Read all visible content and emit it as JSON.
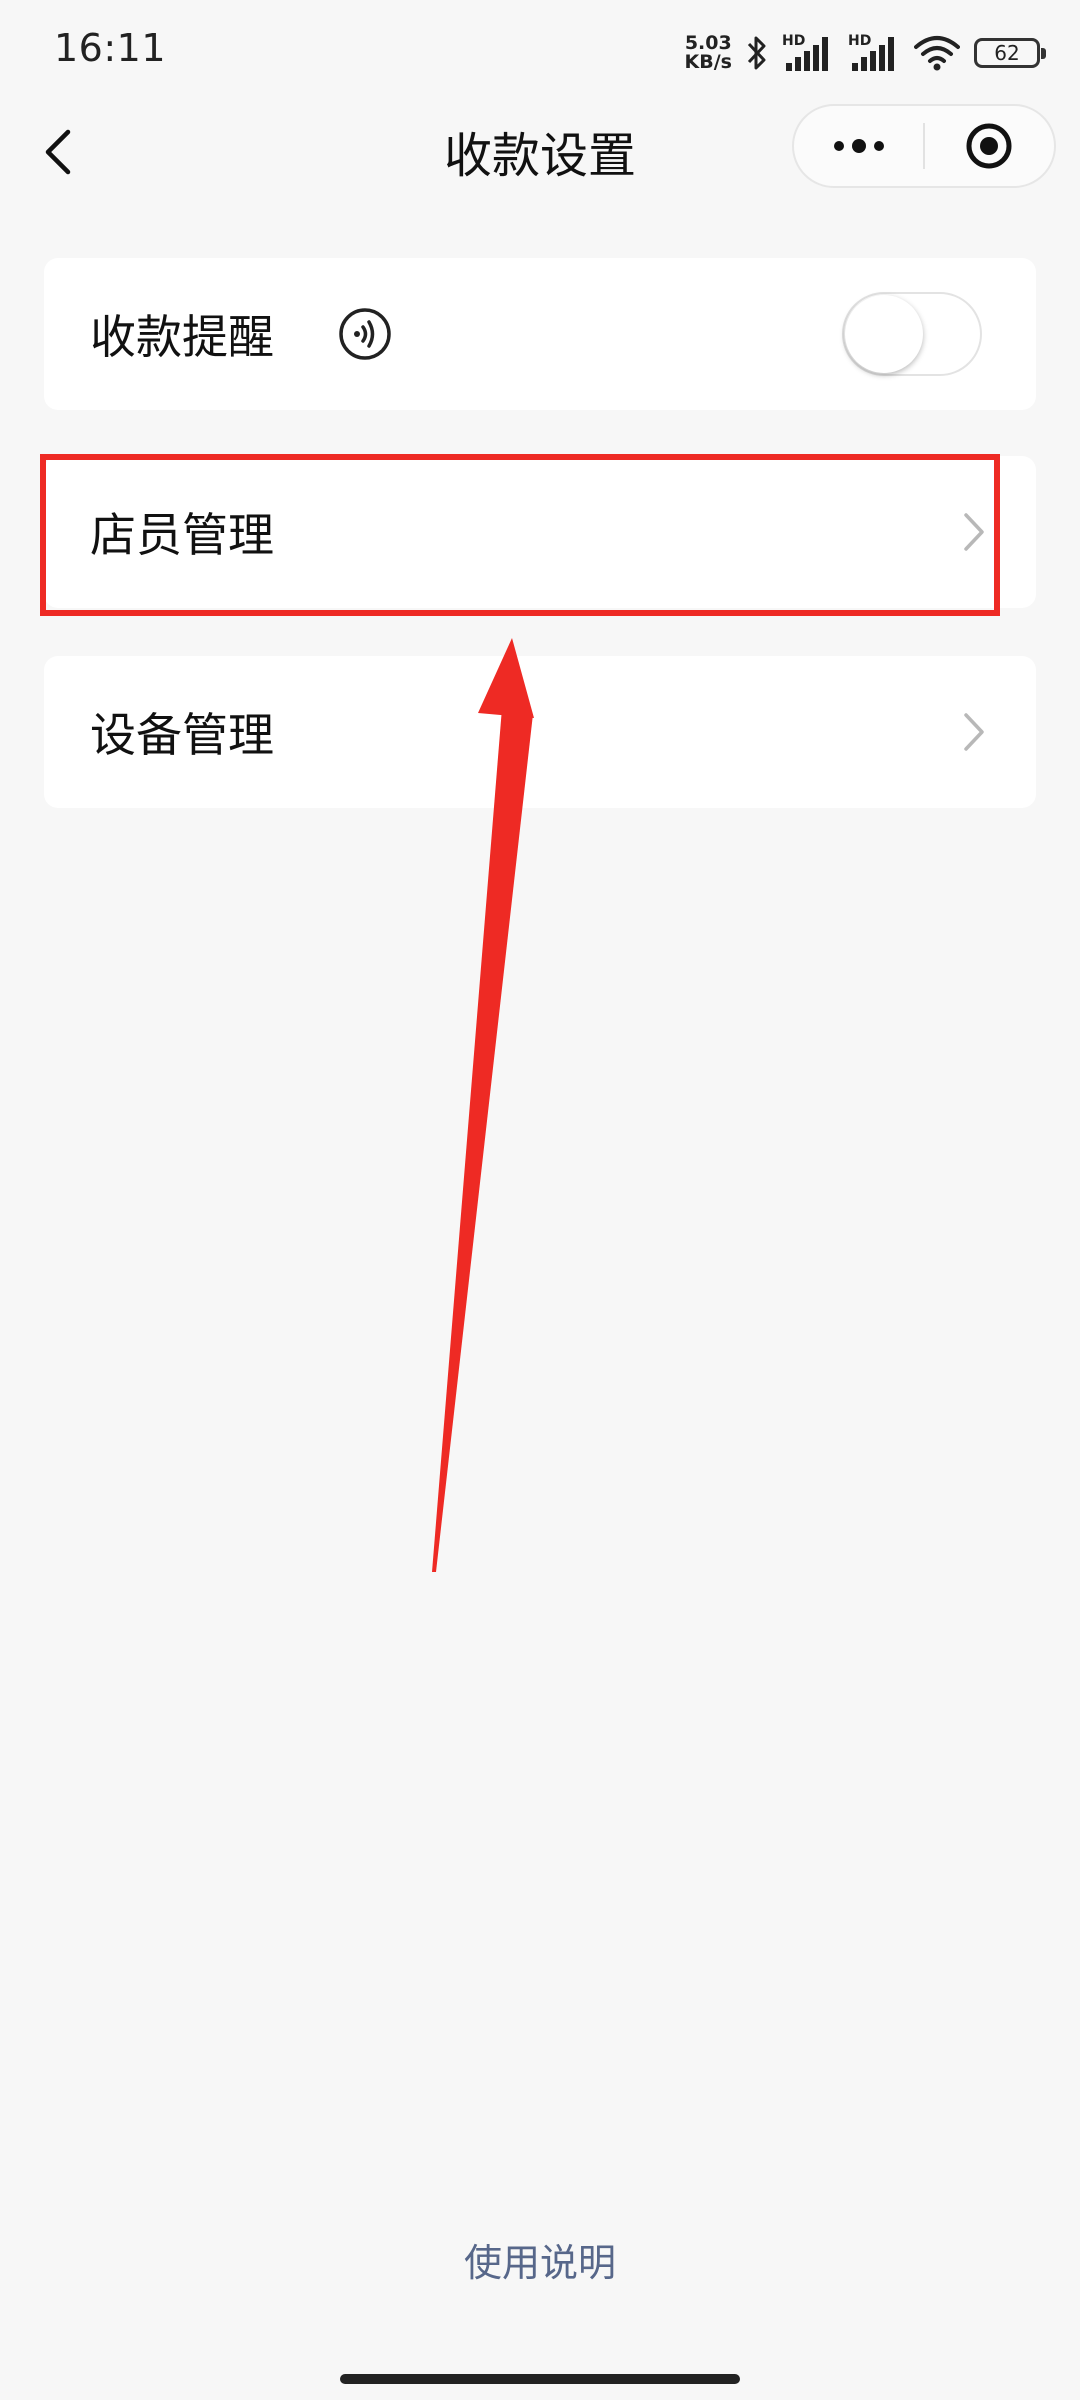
{
  "status_bar": {
    "time": "16:11",
    "net_speed_value": "5.03",
    "net_speed_unit": "KB/s",
    "sim1_label": "HD",
    "sim2_label": "HD",
    "battery_level": "62",
    "icons": [
      "bluetooth-icon",
      "signal-icon",
      "signal-icon",
      "wifi-icon",
      "battery-icon"
    ]
  },
  "nav": {
    "title": "收款设置",
    "icons": {
      "back": "back-icon",
      "more": "more-icon",
      "close": "close-miniprogram-icon"
    }
  },
  "settings": {
    "payment_reminder": {
      "label": "收款提醒",
      "icon": "sound-icon",
      "enabled": false
    },
    "staff_management": {
      "label": "店员管理"
    },
    "device_management": {
      "label": "设备管理"
    }
  },
  "annotation": {
    "color": "#ee2a24",
    "highlighted_item": "staff_management"
  },
  "footer": {
    "link_label": "使用说明",
    "link_color": "#57678a"
  }
}
